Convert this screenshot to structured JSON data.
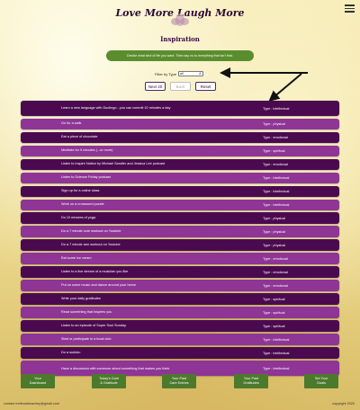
{
  "header": {
    "site_title": "Love More Laugh More",
    "logo_icon": "lotus-icon",
    "menu_icon": "hamburger-menu-icon"
  },
  "page": {
    "heading": "Inspiration",
    "banner": "Decide what kind of life you want. Then say no to everything that isn't that."
  },
  "filter": {
    "label": "Filter by Type",
    "selected": "all"
  },
  "buttons": {
    "next": "Next 20",
    "back": "Back",
    "reset": "Reset"
  },
  "items": [
    {
      "text": "Learn a new language with Duolingo - you can commit 10 minutes a day",
      "type": "Type : intellectual",
      "style": "dark"
    },
    {
      "text": "Go for a walk",
      "type": "Type : physical",
      "style": "light"
    },
    {
      "text": "Eat a piece of chocolate",
      "type": "Type : emotional",
      "style": "dark"
    },
    {
      "text": "Meditate for 5 minutes (...or more)",
      "type": "Type : spiritual",
      "style": "light"
    },
    {
      "text": "Listen to Inspire Nation by Michael Sandler and Jessica Lee podcast",
      "type": "Type : emotional",
      "style": "dark"
    },
    {
      "text": "Listen to Science Friday podcast",
      "type": "Type : intellectual",
      "style": "light"
    },
    {
      "text": "Sign up for a online class",
      "type": "Type : intellectual",
      "style": "dark"
    },
    {
      "text": "Work on a crossword puzzle",
      "type": "Type : intellectual",
      "style": "light"
    },
    {
      "text": "Do 10 minutes of yoga",
      "type": "Type : physical",
      "style": "dark"
    },
    {
      "text": "Do a 7 minute core workout on Youtube",
      "type": "Type : physical",
      "style": "light"
    },
    {
      "text": "Do a 7 minute arm workout on Youtube",
      "type": "Type : physical",
      "style": "dark"
    },
    {
      "text": "Eat some ice cream",
      "type": "Type : emotional",
      "style": "light"
    },
    {
      "text": "Listen to a live stream of a musician you like",
      "type": "Type : emotional",
      "style": "dark"
    },
    {
      "text": "Put on some music and dance around your home",
      "type": "Type : emotional",
      "style": "light"
    },
    {
      "text": "Write your daily gratitudes",
      "type": "Type : spiritual",
      "style": "dark"
    },
    {
      "text": "Read something that inspires you",
      "type": "Type : spiritual",
      "style": "light"
    },
    {
      "text": "Listen to an episode of Super Soul Sunday",
      "type": "Type : spiritual",
      "style": "dark"
    },
    {
      "text": "Start or participate in a book club",
      "type": "Type : intellectual",
      "style": "light"
    },
    {
      "text": "Do a sudoku",
      "type": "Type : intellectual",
      "style": "dark"
    },
    {
      "text": "Have a discussion with someone about something that makes you think",
      "type": "Type : intellectual",
      "style": "light"
    }
  ],
  "nav": [
    {
      "line1": "Your",
      "line2": "Dashboard"
    },
    {
      "line1": "Today's Care",
      "line2": "& Gratitude"
    },
    {
      "line1": "Your Past",
      "line2": "Care Entries"
    },
    {
      "line1": "Your Past",
      "line2": "Gratitudes"
    },
    {
      "line1": "Set Your",
      "line2": "Goals"
    }
  ],
  "footer": {
    "contact": "contact melindabeachey@gmail.com",
    "copyright": "copyright 2020"
  },
  "colors": {
    "row_dark": "#4b0a4f",
    "row_light": "#8e3596",
    "banner": "#5a8d2e",
    "nav_button": "#4c7a2d"
  }
}
